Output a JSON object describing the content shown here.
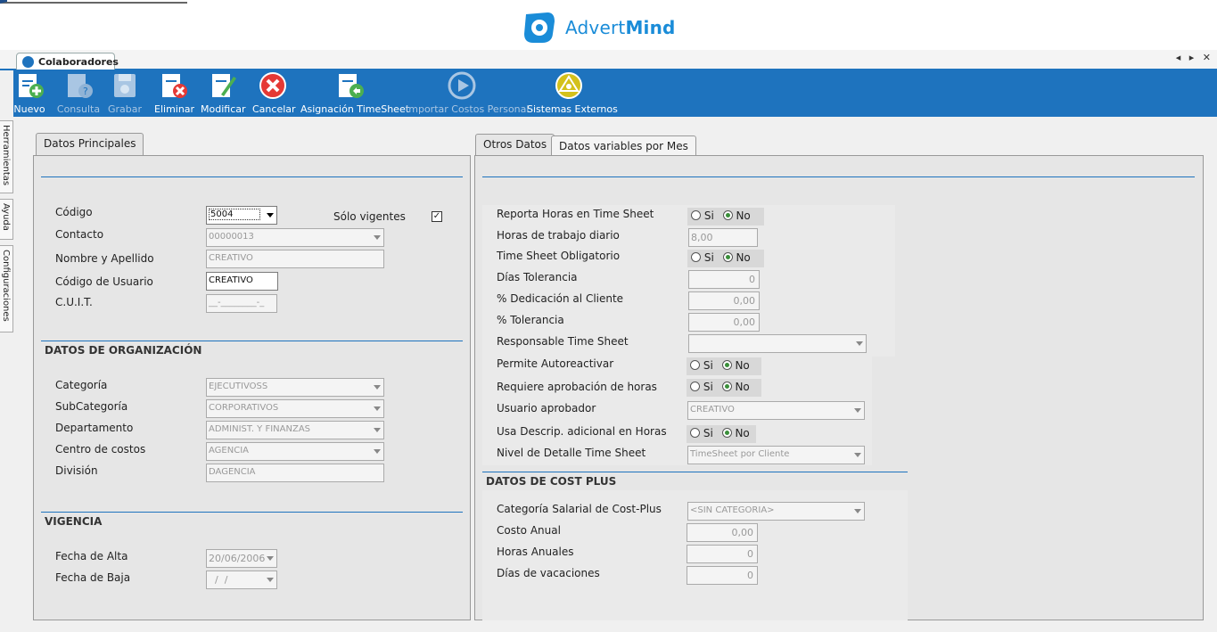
{
  "header": {
    "logo_text_regular": "Advert",
    "logo_text_bold": "Mind"
  },
  "tabstrip": {
    "doc_tab": "Colaboradores",
    "controls": "◂ ▸ ✕"
  },
  "toolbar": {
    "buttons": [
      {
        "label": "Nuevo",
        "enabled": true
      },
      {
        "label": "Consulta",
        "enabled": false
      },
      {
        "label": "Grabar",
        "enabled": false
      },
      {
        "label": "Eliminar",
        "enabled": true
      },
      {
        "label": "Modificar",
        "enabled": true
      },
      {
        "label": "Cancelar",
        "enabled": true
      },
      {
        "label": "Asignación TimeSheet",
        "enabled": true
      },
      {
        "label": "Importar Costos Personal",
        "enabled": false
      },
      {
        "label": "Sistemas Externos",
        "enabled": true
      }
    ]
  },
  "sidetabs": [
    "Herramientas",
    "Ayuda",
    "Configuraciones"
  ],
  "left": {
    "tab": "Datos Principales",
    "codigo_label": "Código",
    "codigo_value": "5004",
    "solo_vigentes_label": "Sólo vigentes",
    "solo_vigentes_checked": true,
    "contacto_label": "Contacto",
    "contacto_value": "00000013",
    "nombre_label": "Nombre y Apellido",
    "nombre_value": "CREATIVO",
    "usuario_label": "Código de Usuario",
    "usuario_value": "CREATIVO",
    "cuit_label": "C.U.I.T.",
    "cuit_value": "__-________-_",
    "org_title": "DATOS DE ORGANIZACIÓN",
    "categoria_label": "Categoría",
    "categoria_value": "EJECUTIVOSS",
    "subcategoria_label": "SubCategoría",
    "subcategoria_value": "CORPORATIVOS",
    "departamento_label": "Departamento",
    "departamento_value": "ADMINIST. Y FINANZAS",
    "centro_label": "Centro de costos",
    "centro_value": "AGENCIA",
    "division_label": "División",
    "division_value": "DAGENCIA",
    "vigencia_title": "VIGENCIA",
    "alta_label": "Fecha de Alta",
    "alta_value": "20/06/2006",
    "baja_label": "Fecha de Baja",
    "baja_value": "  /  /"
  },
  "right": {
    "tab_otros": "Otros Datos",
    "tab_variables": "Datos variables por Mes",
    "si": "Si",
    "no": "No",
    "reporta_label": "Reporta Horas en Time Sheet",
    "horas_label": "Horas de trabajo diario",
    "horas_value": "8,00",
    "obligatorio_label": "Time Sheet Obligatorio",
    "dias_tol_label": "Días Tolerancia",
    "dias_tol_value": "0",
    "dedicacion_label": "% Dedicación al Cliente",
    "dedicacion_value": "0,00",
    "tolerancia_label": "% Tolerancia",
    "tolerancia_value": "0,00",
    "responsable_label": "Responsable Time Sheet",
    "responsable_value": "",
    "autoreactivar_label": "Permite Autoreactivar",
    "aprobacion_label": "Requiere aprobación de horas",
    "aprobador_label": "Usuario aprobador",
    "aprobador_value": "CREATIVO",
    "descrip_label": "Usa Descrip. adicional en Horas",
    "nivel_label": "Nivel de Detalle Time Sheet",
    "nivel_value": "TimeSheet por Cliente",
    "cost_title": "DATOS DE COST PLUS",
    "cat_salarial_label": "Categoría Salarial de Cost-Plus",
    "cat_salarial_value": "<SIN CATEGORIA>",
    "costo_label": "Costo Anual",
    "costo_value": "0,00",
    "horas_anuales_label": "Horas Anuales",
    "horas_anuales_value": "0",
    "vacaciones_label": "Días de vacaciones",
    "vacaciones_value": "0"
  },
  "colors": {
    "accent": "#1e73be",
    "brand": "#1a8cd8"
  }
}
